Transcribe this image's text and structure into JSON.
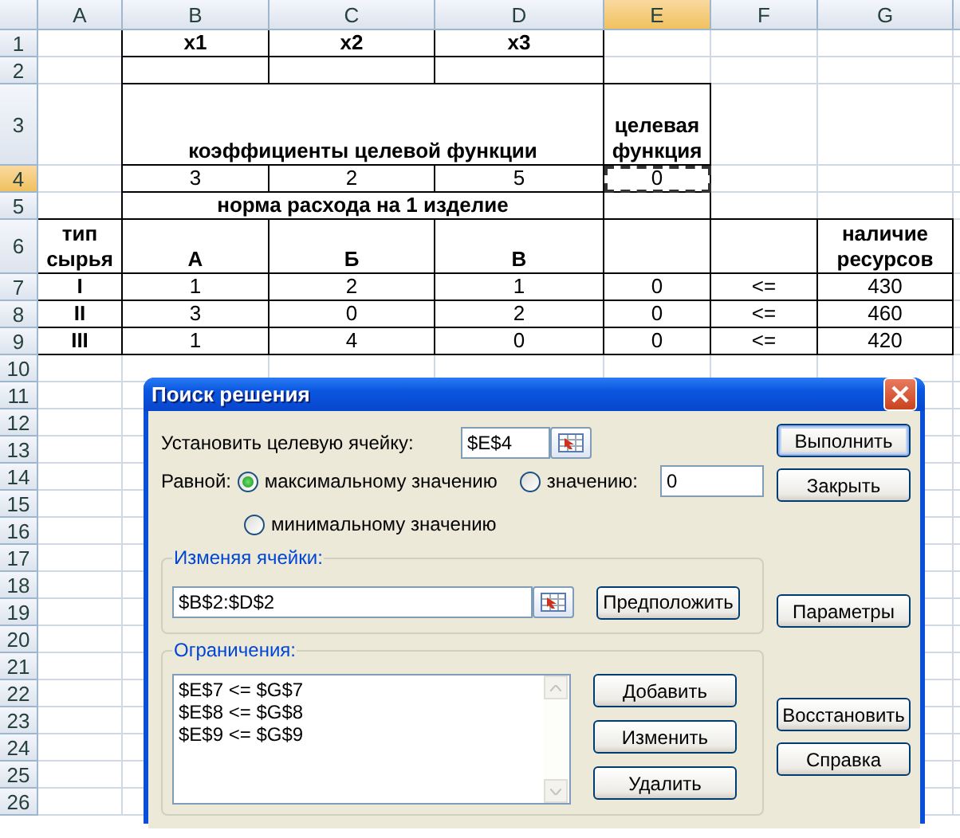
{
  "sheet": {
    "columns": [
      {
        "label": "A",
        "selected": false
      },
      {
        "label": "B",
        "selected": false
      },
      {
        "label": "C",
        "selected": false
      },
      {
        "label": "D",
        "selected": false
      },
      {
        "label": "E",
        "selected": true
      },
      {
        "label": "F",
        "selected": false
      },
      {
        "label": "G",
        "selected": false
      }
    ],
    "rows": [
      {
        "number": "1",
        "selected": false,
        "cells": [
          "",
          "x1",
          "x2",
          "x3",
          "",
          "",
          ""
        ]
      },
      {
        "number": "2",
        "selected": false,
        "cells": [
          "",
          "",
          "",
          "",
          "",
          "",
          ""
        ]
      },
      {
        "number": "3",
        "selected": false,
        "cells": [
          "",
          "коэффициенты целевой функции",
          "",
          "",
          "целевая функция",
          "",
          ""
        ]
      },
      {
        "number": "4",
        "selected": true,
        "cells": [
          "",
          "3",
          "2",
          "5",
          "0",
          "",
          ""
        ]
      },
      {
        "number": "5",
        "selected": false,
        "cells": [
          "",
          "норма расхода на 1 изделие",
          "",
          "",
          "",
          "",
          ""
        ]
      },
      {
        "number": "6",
        "selected": false,
        "cells": [
          "тип сырья",
          "А",
          "Б",
          "В",
          "",
          "",
          "наличие ресурсов"
        ]
      },
      {
        "number": "7",
        "selected": false,
        "cells": [
          "I",
          "1",
          "2",
          "1",
          "0",
          "<=",
          "430"
        ]
      },
      {
        "number": "8",
        "selected": false,
        "cells": [
          "II",
          "3",
          "0",
          "2",
          "0",
          "<=",
          "460"
        ]
      },
      {
        "number": "9",
        "selected": false,
        "cells": [
          "III",
          "1",
          "4",
          "0",
          "0",
          "<=",
          "420"
        ]
      },
      {
        "number": "10",
        "selected": false,
        "cells": []
      },
      {
        "number": "11",
        "selected": false,
        "cells": []
      },
      {
        "number": "12",
        "selected": false,
        "cells": []
      },
      {
        "number": "13",
        "selected": false,
        "cells": []
      },
      {
        "number": "14",
        "selected": false,
        "cells": []
      },
      {
        "number": "15",
        "selected": false,
        "cells": []
      },
      {
        "number": "16",
        "selected": false,
        "cells": []
      },
      {
        "number": "17",
        "selected": false,
        "cells": []
      },
      {
        "number": "18",
        "selected": false,
        "cells": []
      },
      {
        "number": "19",
        "selected": false,
        "cells": []
      },
      {
        "number": "20",
        "selected": false,
        "cells": []
      },
      {
        "number": "21",
        "selected": false,
        "cells": []
      },
      {
        "number": "22",
        "selected": false,
        "cells": []
      },
      {
        "number": "23",
        "selected": false,
        "cells": []
      },
      {
        "number": "24",
        "selected": false,
        "cells": []
      },
      {
        "number": "25",
        "selected": false,
        "cells": []
      },
      {
        "number": "26",
        "selected": false,
        "cells": []
      }
    ]
  },
  "dialog": {
    "title": "Поиск решения",
    "target": {
      "label": "Установить целевую ячейку:",
      "value": "$E$4"
    },
    "equal_label": "Равной:",
    "options": [
      {
        "label": "максимальному значению",
        "selected": true
      },
      {
        "label": "значению:",
        "selected": false
      },
      {
        "label": "минимальному значению",
        "selected": false
      }
    ],
    "value_field": "0",
    "changing": {
      "title": "Изменяя ячейки:",
      "value": "$B$2:$D$2",
      "button": "Предположить"
    },
    "constraints": {
      "title": "Ограничения:",
      "items": [
        "$E$7 <= $G$7",
        "$E$8 <= $G$8",
        "$E$9 <= $G$9"
      ],
      "buttons": [
        "Добавить",
        "Изменить",
        "Удалить"
      ]
    },
    "side_buttons": [
      {
        "label": "Выполнить",
        "default": true
      },
      {
        "label": "Закрыть",
        "default": false
      },
      {
        "label": "Параметры",
        "default": false
      },
      {
        "label": "Восстановить",
        "default": false
      },
      {
        "label": "Справка",
        "default": false
      }
    ]
  }
}
